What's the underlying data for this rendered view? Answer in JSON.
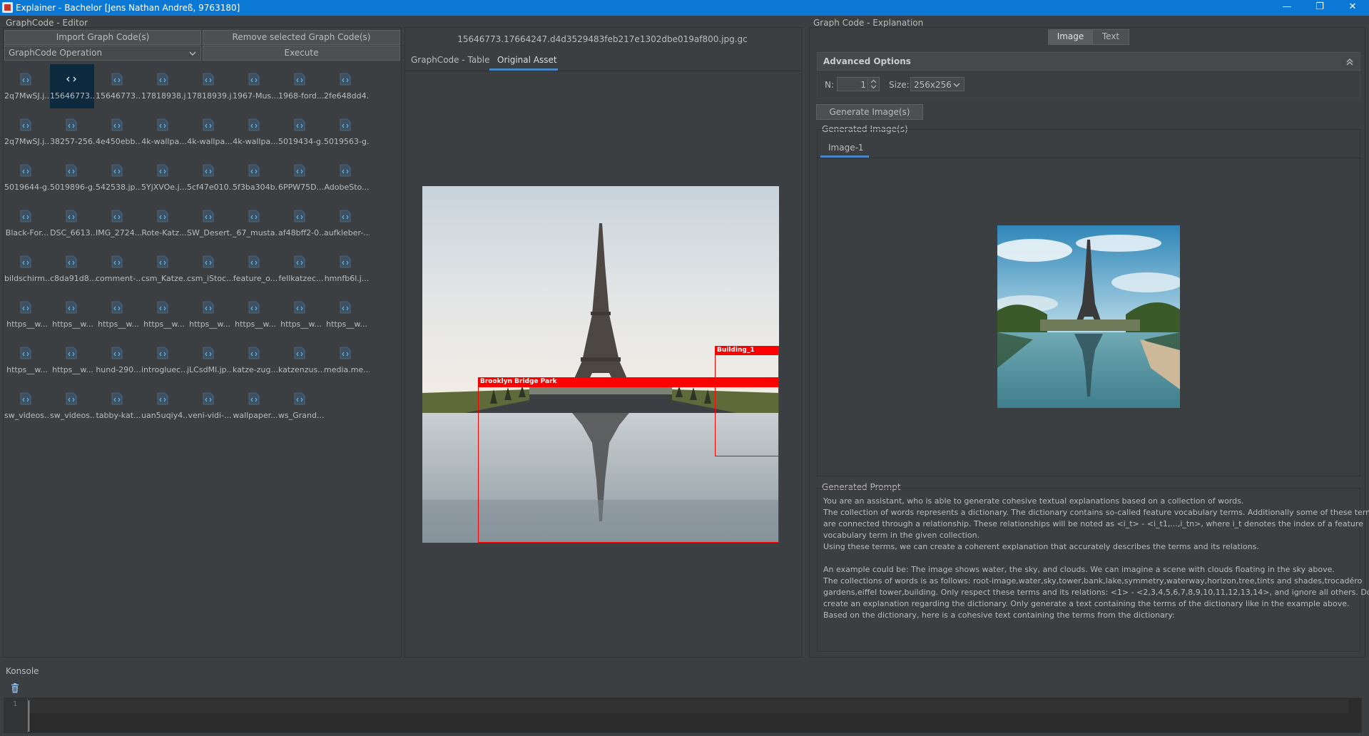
{
  "window": {
    "title": "Explainer - Bachelor [Jens Nathan Andreß, 9763180]",
    "controls": {
      "minimize": "—",
      "maximize": "❐",
      "close": "✕"
    }
  },
  "editor": {
    "group_title": "GraphCode - Editor",
    "import_label": "Import Graph Code(s)",
    "remove_label": "Remove selected Graph Code(s)",
    "operation_value": "GraphCode Operation",
    "execute_label": "Execute",
    "files": [
      "2q7MwSJ.j...",
      "15646773....",
      "15646773....",
      "17818938.j...",
      "17818939.j...",
      "1967-Mus...",
      "1968-ford...",
      "2fe648dd4...",
      "2q7MwSJ.j...",
      "38257-256...",
      "4e450ebb...",
      "4k-wallpa...",
      "4k-wallpa...",
      "4k-wallpa...",
      "5019434-g...",
      "5019563-g...",
      "5019644-g...",
      "5019896-g...",
      "542538.jp...",
      "5YjXVOe.j...",
      "5cf47e010...",
      "5f3ba304b...",
      "6PPW75D....",
      "AdobeSto...",
      "Black-For...",
      "DSC_6613....",
      "IMG_2724....",
      "Rote-Katz...",
      "SW_Desert...",
      "_67_musta...",
      "af48bff2-0...",
      "aufkleber-...",
      "bildschirm...",
      "c8da91d8...",
      "comment-...",
      "csm_Katze...",
      "csm_iStoc...",
      "feature_o...",
      "fellkatzec...",
      "hmnfb6l.j...",
      "https__w...",
      "https__w...",
      "https__w...",
      "https__w...",
      "https__w...",
      "https__w...",
      "https__w...",
      "https__w...",
      "https__w...",
      "https__w...",
      "hund-290...",
      "introgluec...",
      "jLCsdMl.jp...",
      "katze-zug...",
      "katzenzus...",
      "media.me...",
      "sw_videos...",
      "sw_videos...",
      "tabby-kat...",
      "uan5uqiy4...",
      "veni-vidi-...",
      "wallpaper...",
      "ws_Grand..."
    ]
  },
  "viewer": {
    "filename": "15646773.17664247.d4d3529483feb217e1302dbe019af800.jpg.gc",
    "tabs": [
      "GraphCode - Table",
      "Original Asset"
    ],
    "active_tab": "Original Asset",
    "bbox_labels": [
      "Building_1",
      "Brooklyn Bridge Park"
    ]
  },
  "explanation": {
    "group_title": "Graph Code - Explanation",
    "toggle": [
      "Image",
      "Text"
    ],
    "active_toggle": "Image",
    "advanced_title": "Advanced Options",
    "n_label": "N:",
    "n_value": "1",
    "size_label": "Size:",
    "size_value": "256x256",
    "generate_label": "Generate Image(s)",
    "generated_title": "Generated Image(s)",
    "image_tab": "Image-1",
    "prompt_title": "Generated Prompt",
    "prompt_lines": [
      "You are an assistant, who is able to generate cohesive textual explanations based on a collection of words.",
      "The collection of words represents a dictionary. The dictionary contains so-called feature vocabulary terms. Additionally some of these terms",
      "are connected through a relationship. These relationships will be noted as <i_t> - <i_t1,...,i_tn>, where i_t denotes the index of a feature",
      "vocabulary term in the given collection.",
      "Using these terms, we can create a coherent explanation that accurately describes the terms and its relations.",
      "",
      "An example could be: The image shows water, the sky, and clouds. We can imagine a scene with clouds floating in the sky above.",
      "The collections of words is as follows: root-image,water,sky,tower,bank,lake,symmetry,waterway,horizon,tree,tints and shades,trocadéro",
      "gardens,eiffel tower,building. Only respect these terms and its relations: <1> - <2,3,4,5,6,7,8,9,10,11,12,13,14>, and ignore all others. Do not",
      "create an explanation regarding the dictionary. Only generate a text containing the terms of the dictionary like in the example above.",
      "Based on the dictionary, here is a cohesive text containing the terms from the dictionary:"
    ]
  },
  "console": {
    "group_title": "Konsole",
    "line_number": "1"
  },
  "colors": {
    "accent": "#0a78d4",
    "selection": "#0d293e",
    "tab_underline": "#4a88c7",
    "bbox": "#ff0000",
    "background": "#3c3f41"
  }
}
